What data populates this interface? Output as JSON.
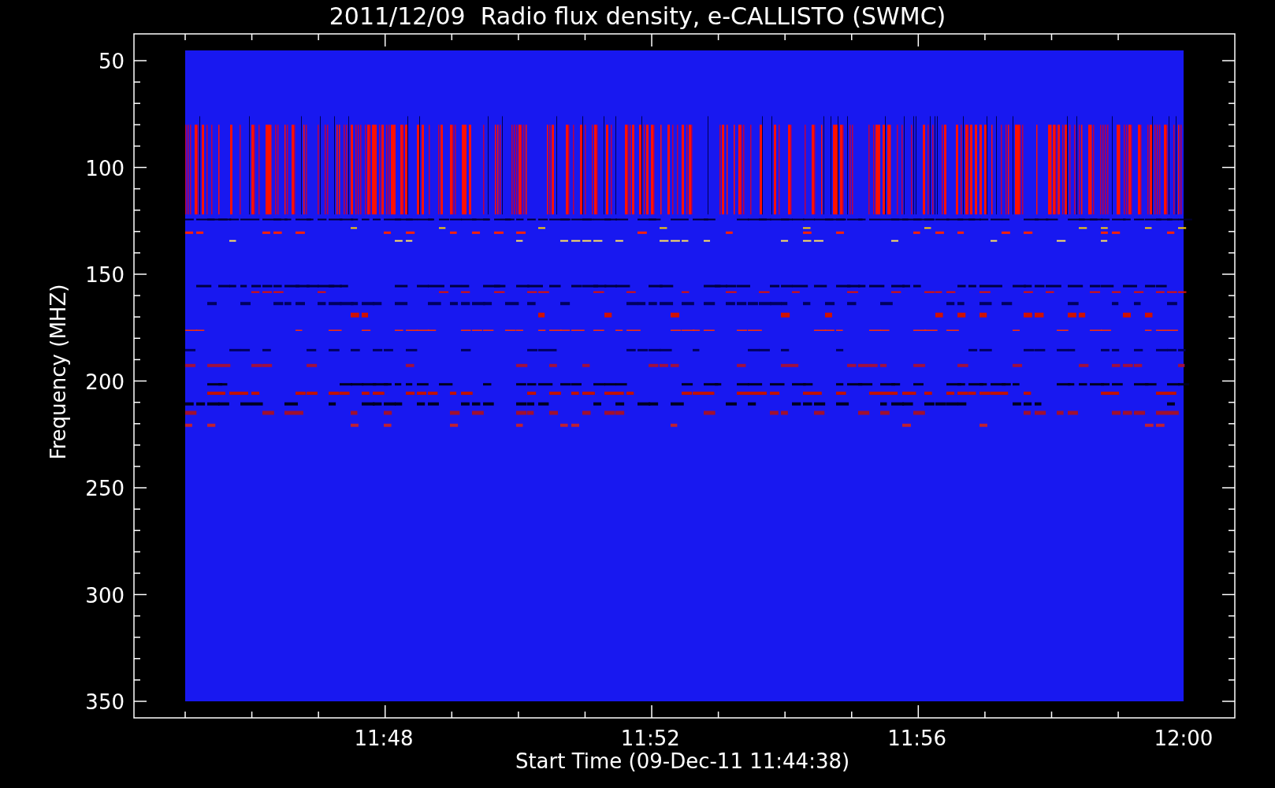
{
  "title": "2011/12/09  Radio flux density, e-CALLISTO (SWMC)",
  "y_axis": {
    "label": "Frequency (MHZ)",
    "ticks": [
      "50",
      "100",
      "150",
      "200",
      "250",
      "300",
      "350"
    ]
  },
  "x_axis": {
    "label": "Start Time (09-Dec-11 11:44:38)",
    "ticks": [
      "11:48",
      "11:52",
      "11:56",
      "12:00"
    ]
  }
}
